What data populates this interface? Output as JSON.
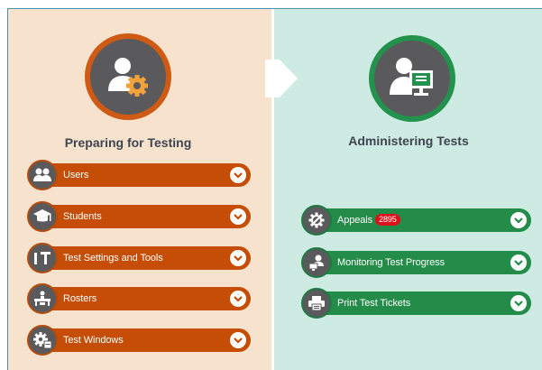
{
  "colors": {
    "left_panel_bg": "#f7e2ce",
    "right_panel_bg": "#cdebe2",
    "orange_accent": "#c54d06",
    "green_accent": "#238c48",
    "icon_gray": "#5a5a5c",
    "badge_red": "#e0101a"
  },
  "preparing": {
    "title": "Preparing for Testing",
    "header_icon": "user-gear-icon",
    "items": [
      {
        "label": "Users",
        "icon": "users-icon"
      },
      {
        "label": "Students",
        "icon": "graduation-cap-icon"
      },
      {
        "label": "Test Settings and Tools",
        "icon": "text-tools-icon"
      },
      {
        "label": "Rosters",
        "icon": "classroom-icon"
      },
      {
        "label": "Test Windows",
        "icon": "gear-calendar-icon"
      }
    ]
  },
  "administering": {
    "title": "Administering Tests",
    "header_icon": "user-monitor-icon",
    "items": [
      {
        "label": "Appeals",
        "icon": "gavel-icon",
        "badge": "2895"
      },
      {
        "label": "Monitoring Test Progress",
        "icon": "user-desk-icon"
      },
      {
        "label": "Print Test Tickets",
        "icon": "printer-icon"
      }
    ]
  }
}
